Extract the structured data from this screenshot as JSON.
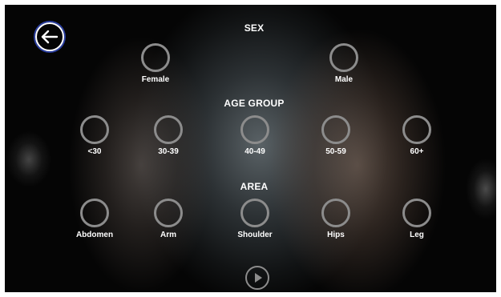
{
  "sections": {
    "sex": "SEX",
    "age_group": "AGE GROUP",
    "area": "AREA"
  },
  "sex_options": [
    {
      "label": "Female"
    },
    {
      "label": "Male"
    }
  ],
  "age_options": [
    {
      "label": "<30"
    },
    {
      "label": "30-39"
    },
    {
      "label": "40-49"
    },
    {
      "label": "50-59"
    },
    {
      "label": "60+"
    }
  ],
  "area_options": [
    {
      "label": "Abdomen"
    },
    {
      "label": "Arm"
    },
    {
      "label": "Shoulder"
    },
    {
      "label": "Hips"
    },
    {
      "label": "Leg"
    }
  ],
  "icons": {
    "back": "back-arrow-icon",
    "play": "play-icon"
  },
  "colors": {
    "ring": "#8c8c8c",
    "back_border": "#2b3fa0",
    "text": "#ffffff"
  }
}
